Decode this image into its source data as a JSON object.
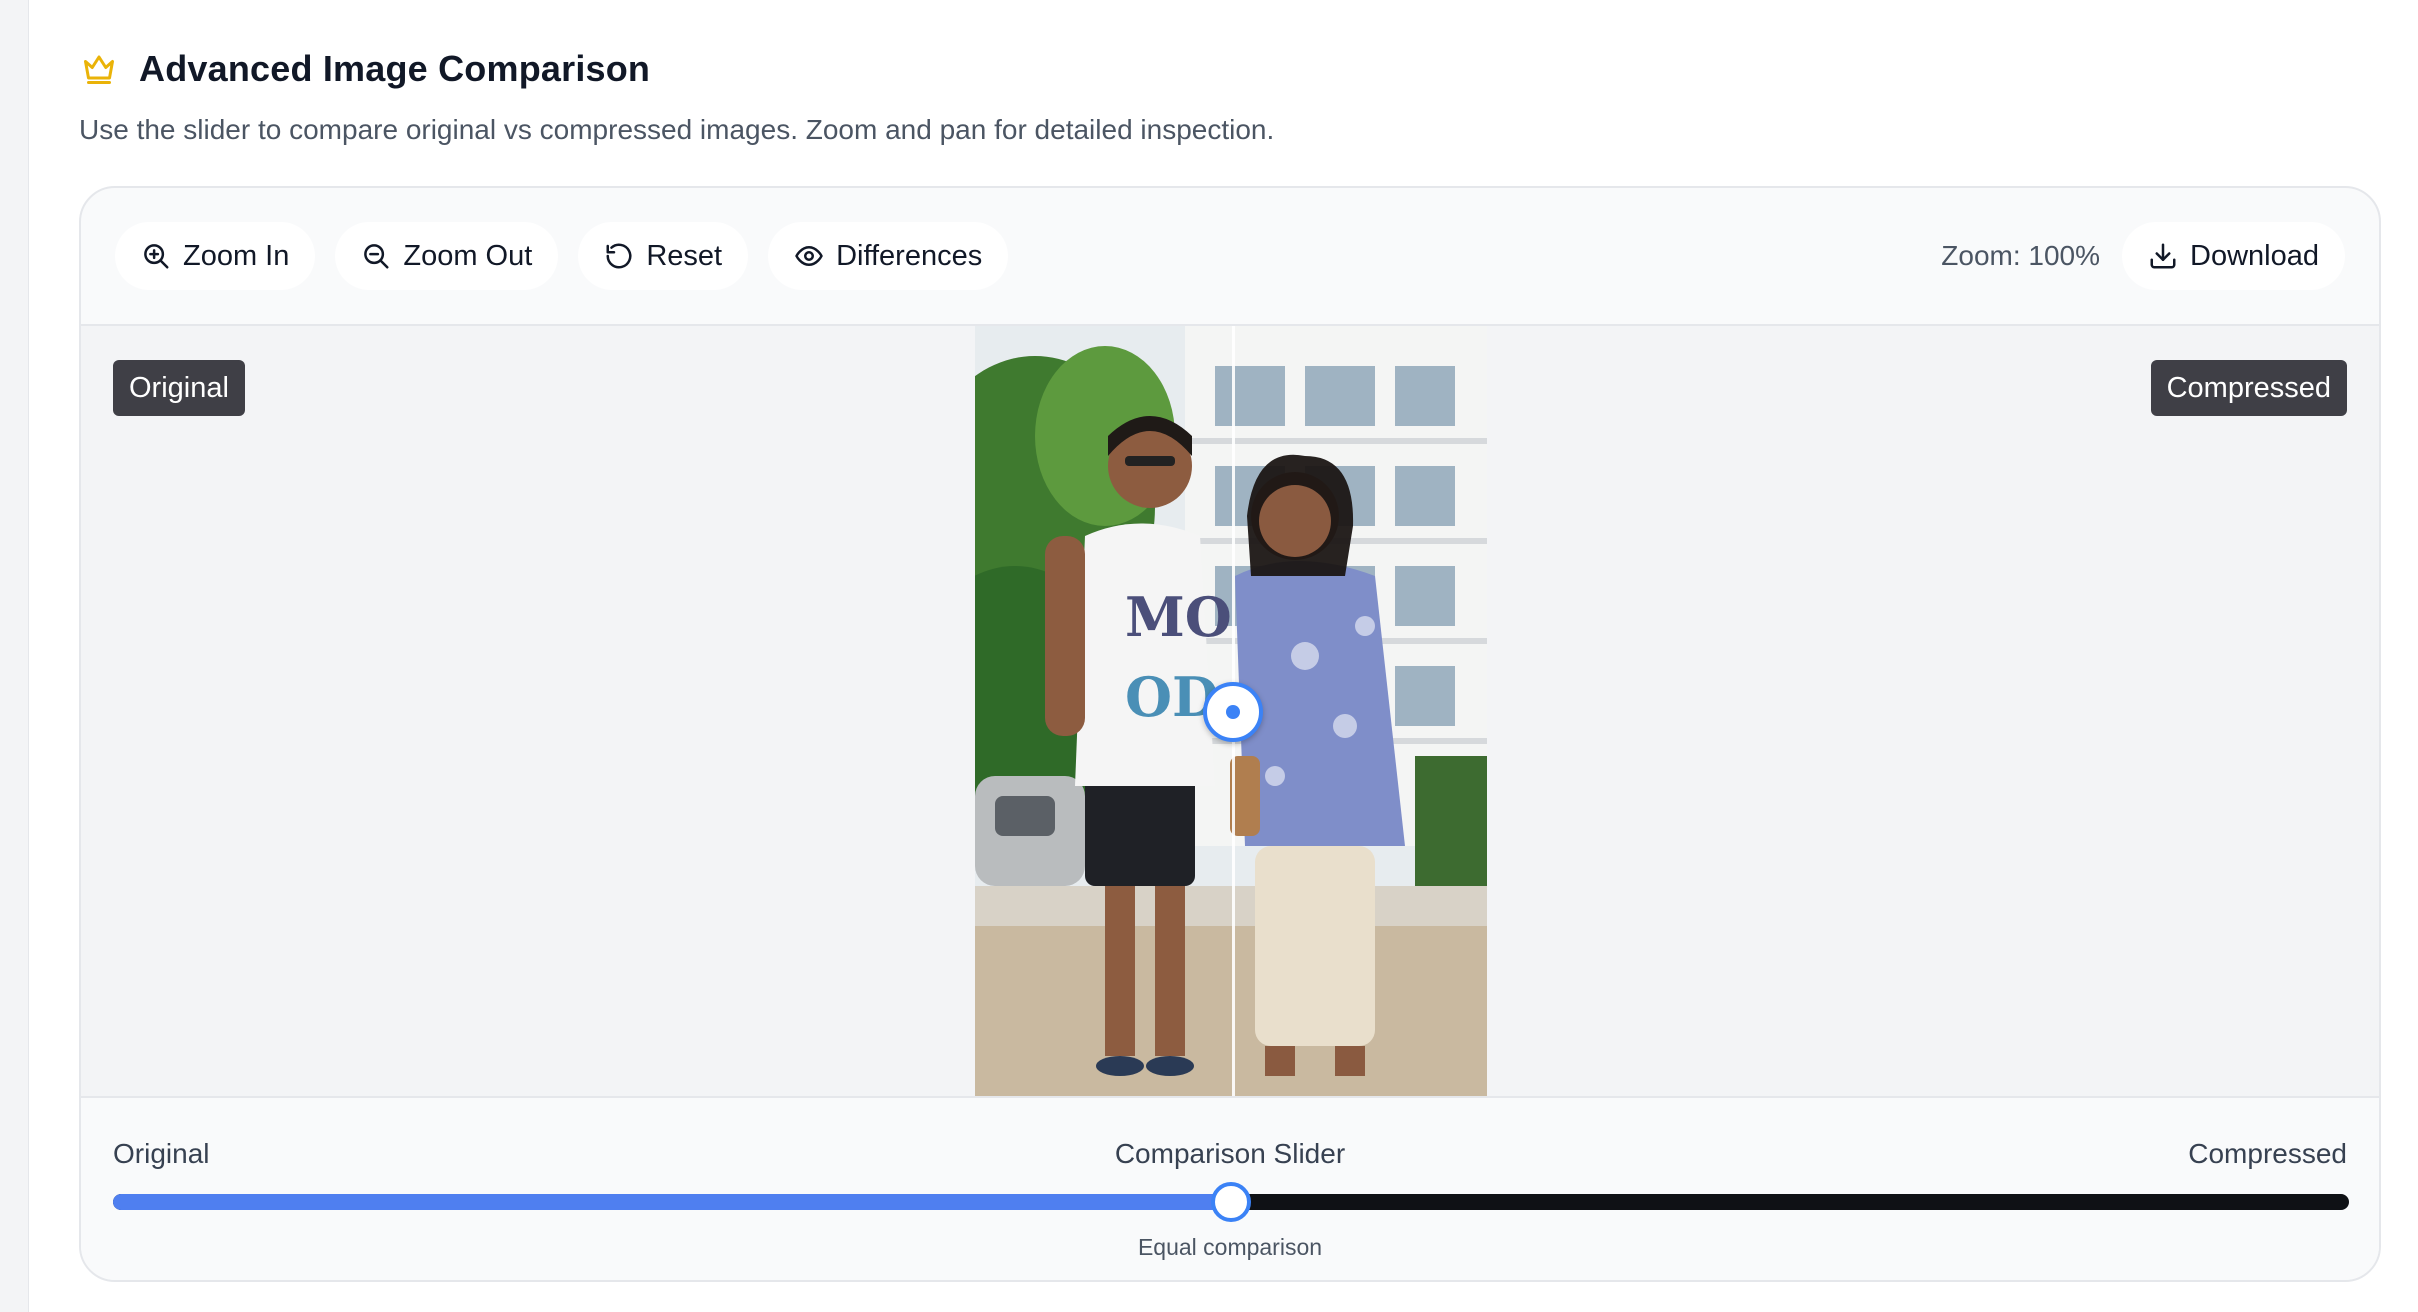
{
  "header": {
    "title": "Advanced Image Comparison",
    "subtitle": "Use the slider to compare original vs compressed images. Zoom and pan for detailed inspection.",
    "icon": "crown-icon",
    "icon_color": "#eab308"
  },
  "toolbar": {
    "zoom_in_label": "Zoom In",
    "zoom_out_label": "Zoom Out",
    "reset_label": "Reset",
    "differences_label": "Differences",
    "zoom_text": "Zoom: 100%",
    "download_label": "Download"
  },
  "stage": {
    "left_tag": "Original",
    "right_tag": "Compressed",
    "split_percent": 50
  },
  "slider": {
    "left_label": "Original",
    "center_label": "Comparison Slider",
    "right_label": "Compressed",
    "value_percent": 50,
    "caption": "Equal comparison",
    "accent_color": "#3b82f6"
  }
}
